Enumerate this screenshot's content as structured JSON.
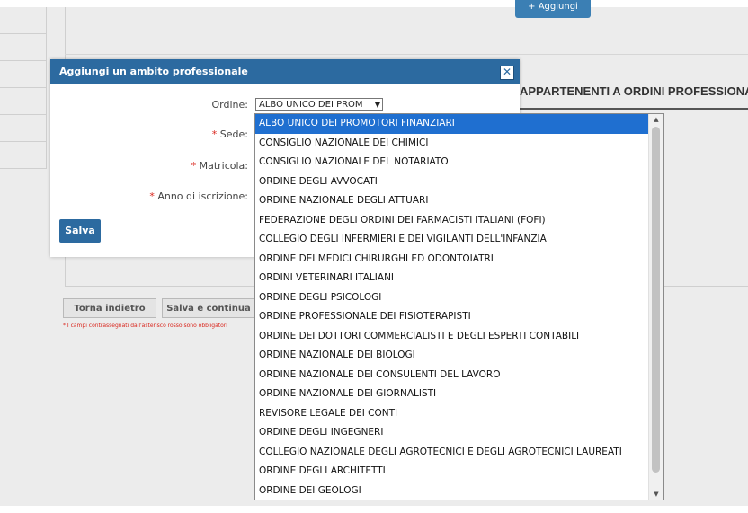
{
  "background": {
    "add_button_label": "+ Aggiungi",
    "section_heading": "APPARTENENTI A ORDINI PROFESSIONALI",
    "back_button": "Torna indietro",
    "save_continue_button": "Salva e continua",
    "required_note": "* I campi contrassegnati dall'asterisco rosso sono obbligatori"
  },
  "modal": {
    "title": "Aggiungi un ambito professionale",
    "close_icon": "close-icon",
    "fields": {
      "ordine_label": "Ordine:",
      "ordine_value": "ALBO UNICO DEI PROM",
      "sede_label": "Sede:",
      "matricola_label": "Matricola:",
      "anno_label": "Anno di iscrizione:"
    },
    "required_mark": "*",
    "save_button": "Salva"
  },
  "dropdown": {
    "selected_index": 0,
    "options": [
      "ALBO UNICO DEI PROMOTORI FINANZIARI",
      "CONSIGLIO NAZIONALE DEI CHIMICI",
      "CONSIGLIO NAZIONALE DEL NOTARIATO",
      "ORDINE DEGLI AVVOCATI",
      "ORDINE NAZIONALE DEGLI ATTUARI",
      "FEDERAZIONE DEGLI ORDINI DEI FARMACISTI ITALIANI (FOFI)",
      "COLLEGIO DEGLI INFERMIERI E DEI VIGILANTI DELL'INFANZIA",
      "ORDINE DEI MEDICI CHIRURGHI ED ODONTOIATRI",
      "ORDINI VETERINARI ITALIANI",
      "ORDINE DEGLI PSICOLOGI",
      "ORDINE PROFESSIONALE DEI FISIOTERAPISTI",
      "ORDINE DEI DOTTORI COMMERCIALISTI E DEGLI ESPERTI CONTABILI",
      "ORDINE NAZIONALE DEI BIOLOGI",
      "ORDINE NAZIONALE DEI CONSULENTI DEL LAVORO",
      "ORDINE NAZIONALE DEI GIORNALISTI",
      "REVISORE LEGALE DEI CONTI",
      "ORDINE DEGLI INGEGNERI",
      "COLLEGIO NAZIONALE DEGLI AGROTECNICI E DEGLI AGROTECNICI LAUREATI",
      "ORDINE DEGLI ARCHITETTI",
      "ORDINE DEI GEOLOGI"
    ]
  },
  "colors": {
    "header_blue": "#2c6aa0",
    "selected_option": "#1f6fd0",
    "required_red": "#d9251c"
  }
}
